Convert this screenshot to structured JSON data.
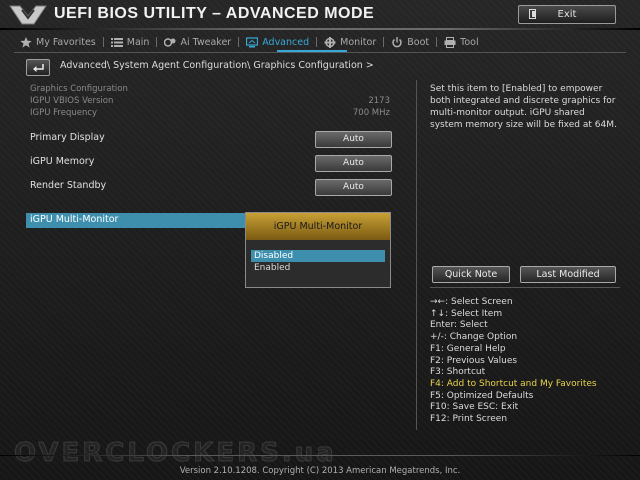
{
  "header": {
    "title": "UEFI BIOS UTILITY – ADVANCED MODE",
    "exit_label": "Exit"
  },
  "tabs": [
    {
      "label": "My Favorites",
      "icon": "star-icon"
    },
    {
      "label": "Main",
      "icon": "list-icon"
    },
    {
      "label": "Ai Tweaker",
      "icon": "tweaker-icon"
    },
    {
      "label": "Advanced",
      "icon": "advanced-icon",
      "active": true
    },
    {
      "label": "Monitor",
      "icon": "monitor-icon"
    },
    {
      "label": "Boot",
      "icon": "power-icon"
    },
    {
      "label": "Tool",
      "icon": "printer-icon"
    }
  ],
  "breadcrumb": "Advanced\\ System Agent Configuration\\ Graphics Configuration >",
  "info": {
    "section_title": "Graphics Configuration",
    "vbios_label": "IGPU VBIOS Version",
    "vbios_value": "2173",
    "freq_label": "IGPU Frequency",
    "freq_value": "700 MHz"
  },
  "settings": [
    {
      "label": "Primary Display",
      "value": "Auto"
    },
    {
      "label": "iGPU Memory",
      "value": "Auto"
    },
    {
      "label": "Render Standby",
      "value": "Auto"
    }
  ],
  "selected_item": "iGPU Multi-Monitor",
  "popup": {
    "title": "iGPU Multi-Monitor",
    "options": [
      "Disabled",
      "Enabled"
    ],
    "selected": "Disabled"
  },
  "help": {
    "text": "Set this item to [Enabled] to empower both integrated and discrete graphics for multi-monitor output. iGPU shared system memory size will be fixed at 64M.",
    "quick_note": "Quick Note",
    "last_modified": "Last Modified"
  },
  "keys": [
    "→←: Select Screen",
    "↑↓: Select Item",
    "Enter: Select",
    "+/-: Change Option",
    "F1: General Help",
    "F2: Previous Values",
    "F3: Shortcut",
    "F4: Add to Shortcut and My Favorites",
    "F5: Optimized Defaults",
    "F10: Save  ESC: Exit",
    "F12: Print Screen"
  ],
  "highlight_key_index": 7,
  "watermark": "OVERCLOCKERS.ua",
  "footer": "Version 2.10.1208. Copyright (C) 2013 American Megatrends, Inc.",
  "colors": {
    "accent": "#38a8d6",
    "selection": "#3e8fae",
    "popup_header": "#c8a035",
    "highlight_text": "#e8d34a"
  }
}
